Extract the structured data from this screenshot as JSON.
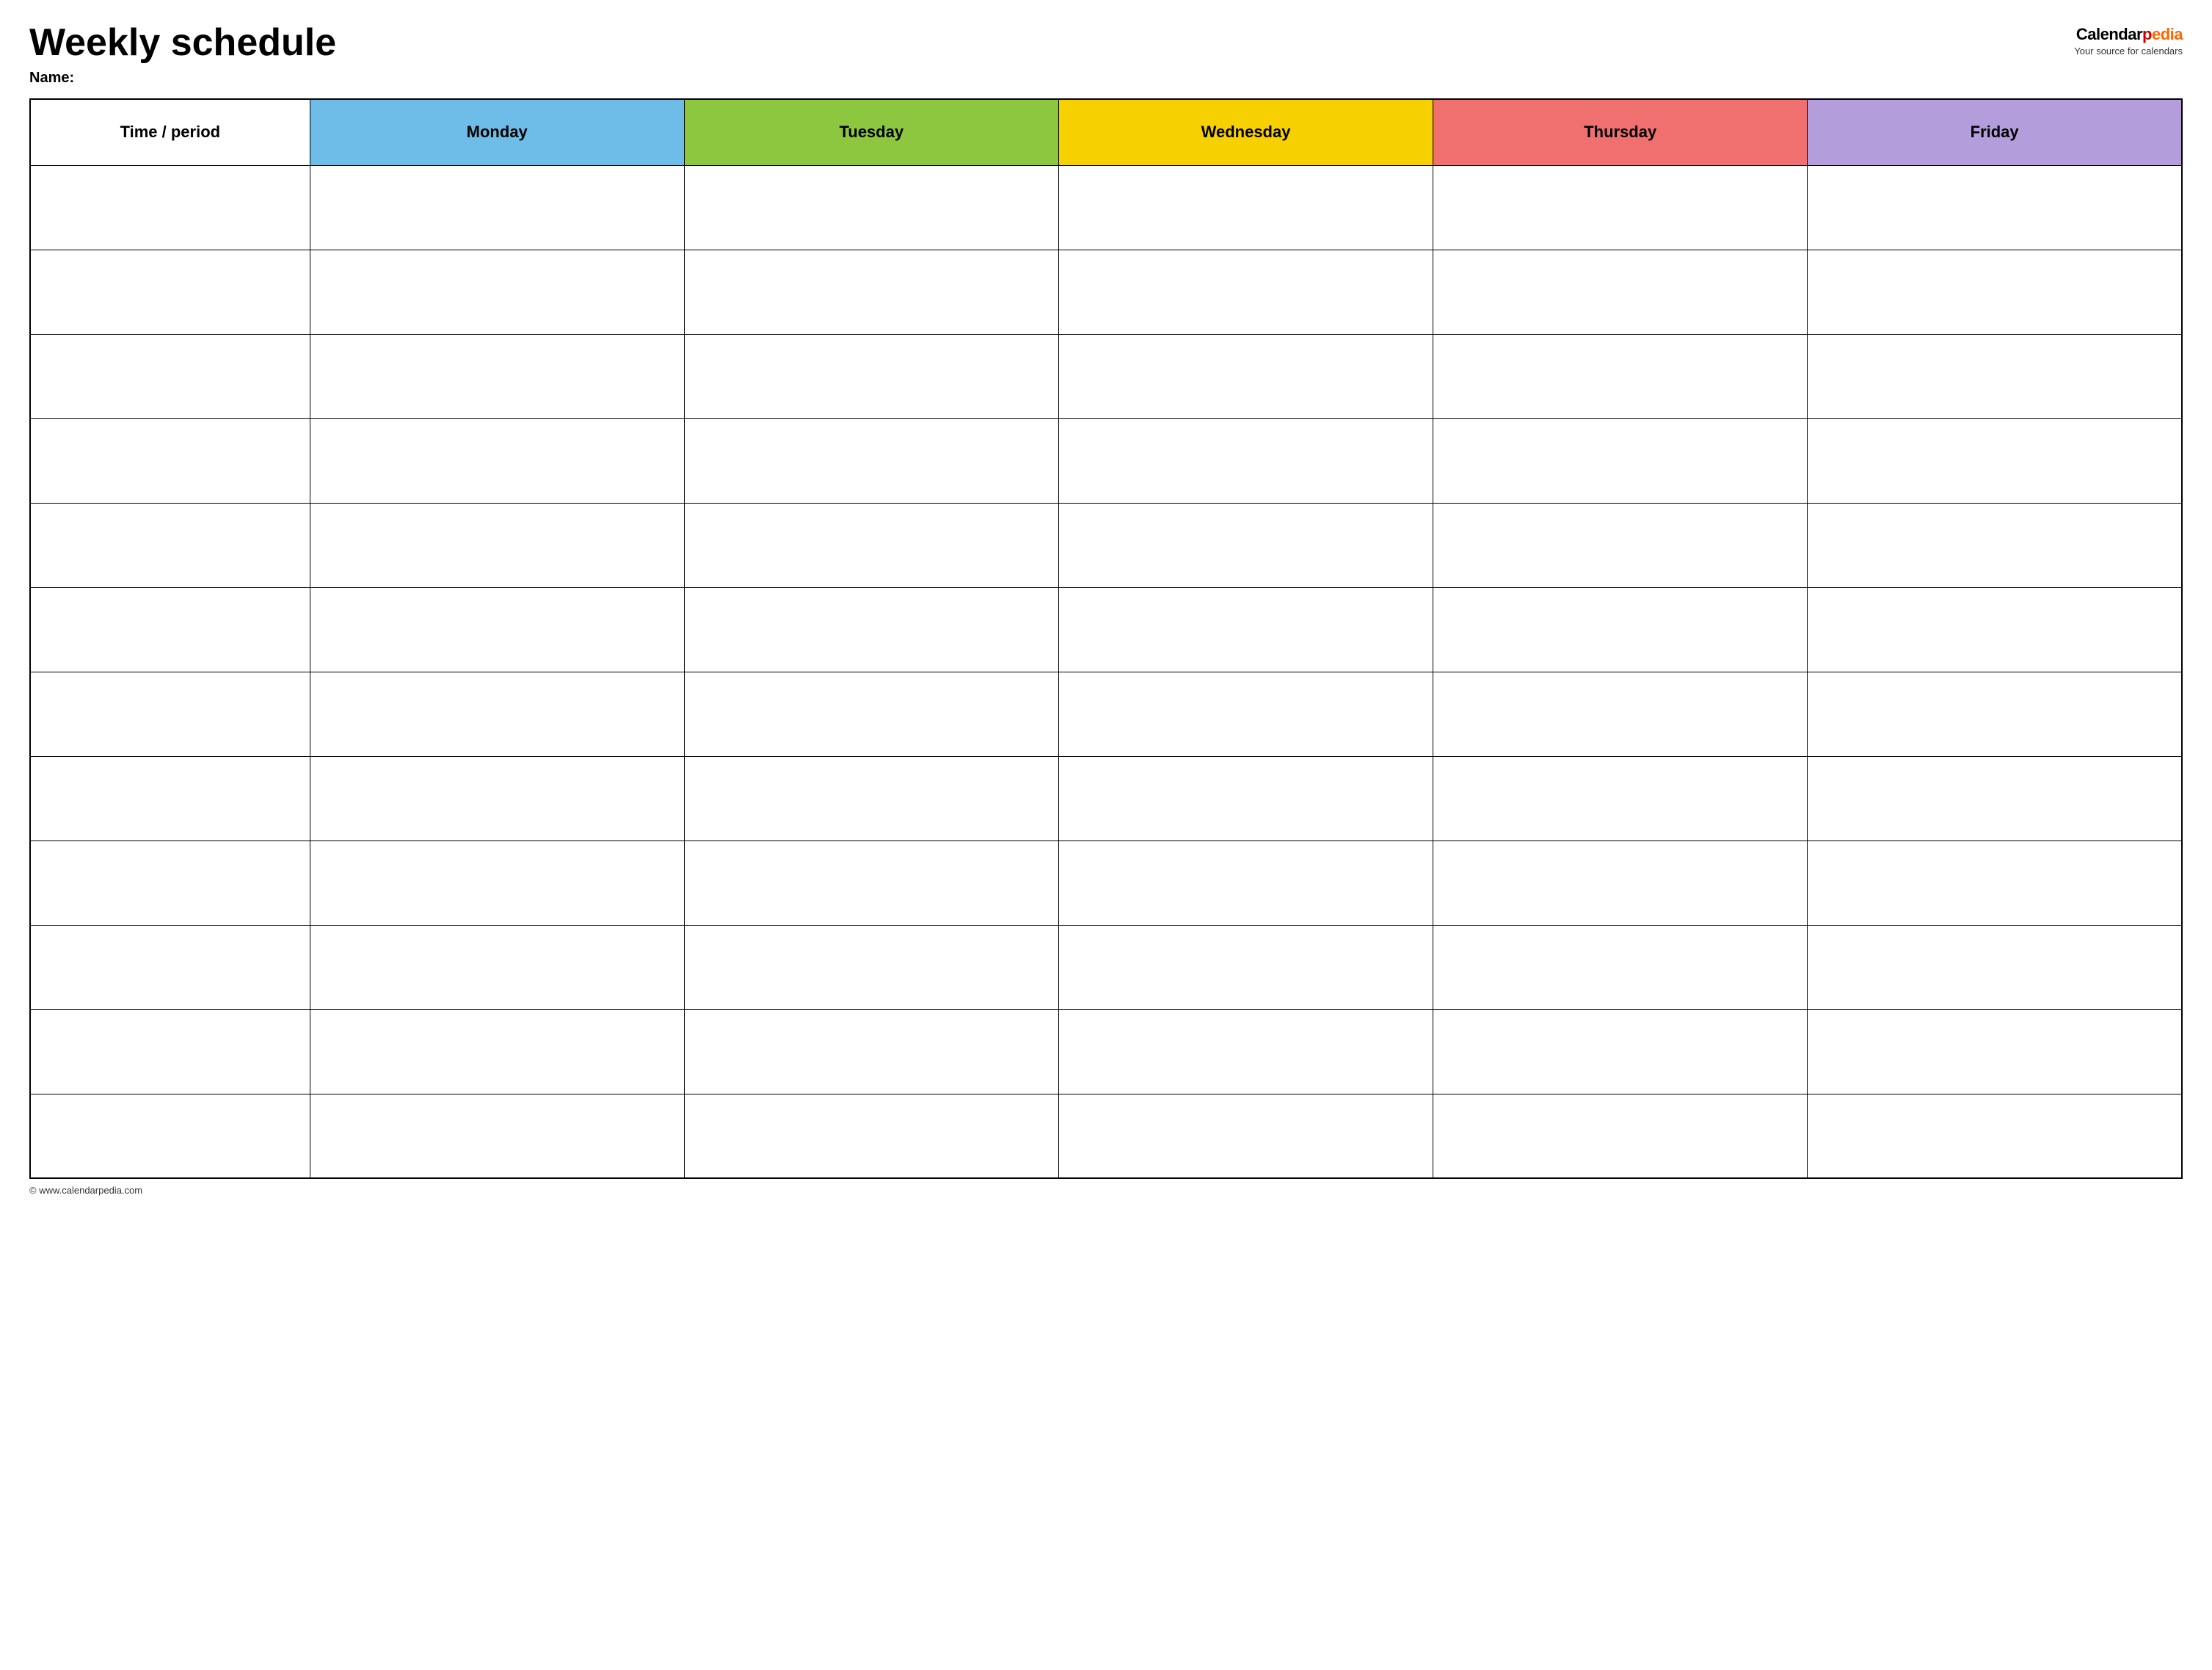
{
  "header": {
    "title": "Weekly schedule",
    "name_label": "Name:",
    "logo": {
      "calendar_text": "Calendar",
      "pedia_text": "pedia",
      "tagline": "Your source for calendars"
    }
  },
  "table": {
    "columns": [
      {
        "key": "time",
        "label": "Time / period",
        "color": "#ffffff"
      },
      {
        "key": "monday",
        "label": "Monday",
        "color": "#6dbde8"
      },
      {
        "key": "tuesday",
        "label": "Tuesday",
        "color": "#8dc63f"
      },
      {
        "key": "wednesday",
        "label": "Wednesday",
        "color": "#f7d000"
      },
      {
        "key": "thursday",
        "label": "Thursday",
        "color": "#f07070"
      },
      {
        "key": "friday",
        "label": "Friday",
        "color": "#b39ddb"
      }
    ],
    "rows": [
      {
        "id": 1
      },
      {
        "id": 2
      },
      {
        "id": 3
      },
      {
        "id": 4
      },
      {
        "id": 5
      },
      {
        "id": 6
      },
      {
        "id": 7
      },
      {
        "id": 8
      },
      {
        "id": 9
      },
      {
        "id": 10
      },
      {
        "id": 11
      },
      {
        "id": 12
      }
    ]
  },
  "footer": {
    "copyright": "© www.calendarpedia.com"
  }
}
